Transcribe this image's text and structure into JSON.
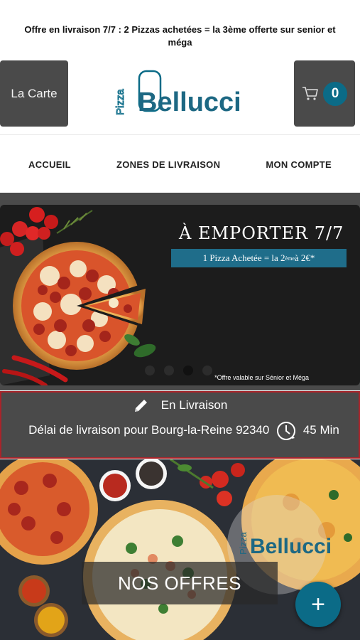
{
  "promo": {
    "text": "Offre en livraison 7/7 : 2 Pizzas achetées = la 3ème offerte sur senior et méga"
  },
  "header": {
    "menu_label": "La Carte",
    "logo_small": "Pizza",
    "logo_big": "Bellucci",
    "cart_count": "0",
    "brand_color": "#0b6b87"
  },
  "nav": {
    "items": [
      "ACCUEIL",
      "ZONES DE LIVRAISON",
      "MON COMPTE"
    ]
  },
  "hero": {
    "title": "À EMPORTER 7/7",
    "subtitle_pre": "1 Pizza Achetée = la 2",
    "subtitle_sup": "ème",
    "subtitle_post": " à 2€*",
    "note": "*Offre valable sur Sénior et Méga",
    "slides_count": 4,
    "active_slide": 3
  },
  "delivery": {
    "mode": "En Livraison",
    "delay_text": "Délai de livraison pour Bourg-la-Reine 92340",
    "delay_value": "45",
    "delay_unit": "Min",
    "border_color": "#a9242a"
  },
  "offers": {
    "label": "NOS OFFRES",
    "logo_small": "Pizza",
    "logo_big": "Bellucci",
    "fab_symbol": "+"
  }
}
